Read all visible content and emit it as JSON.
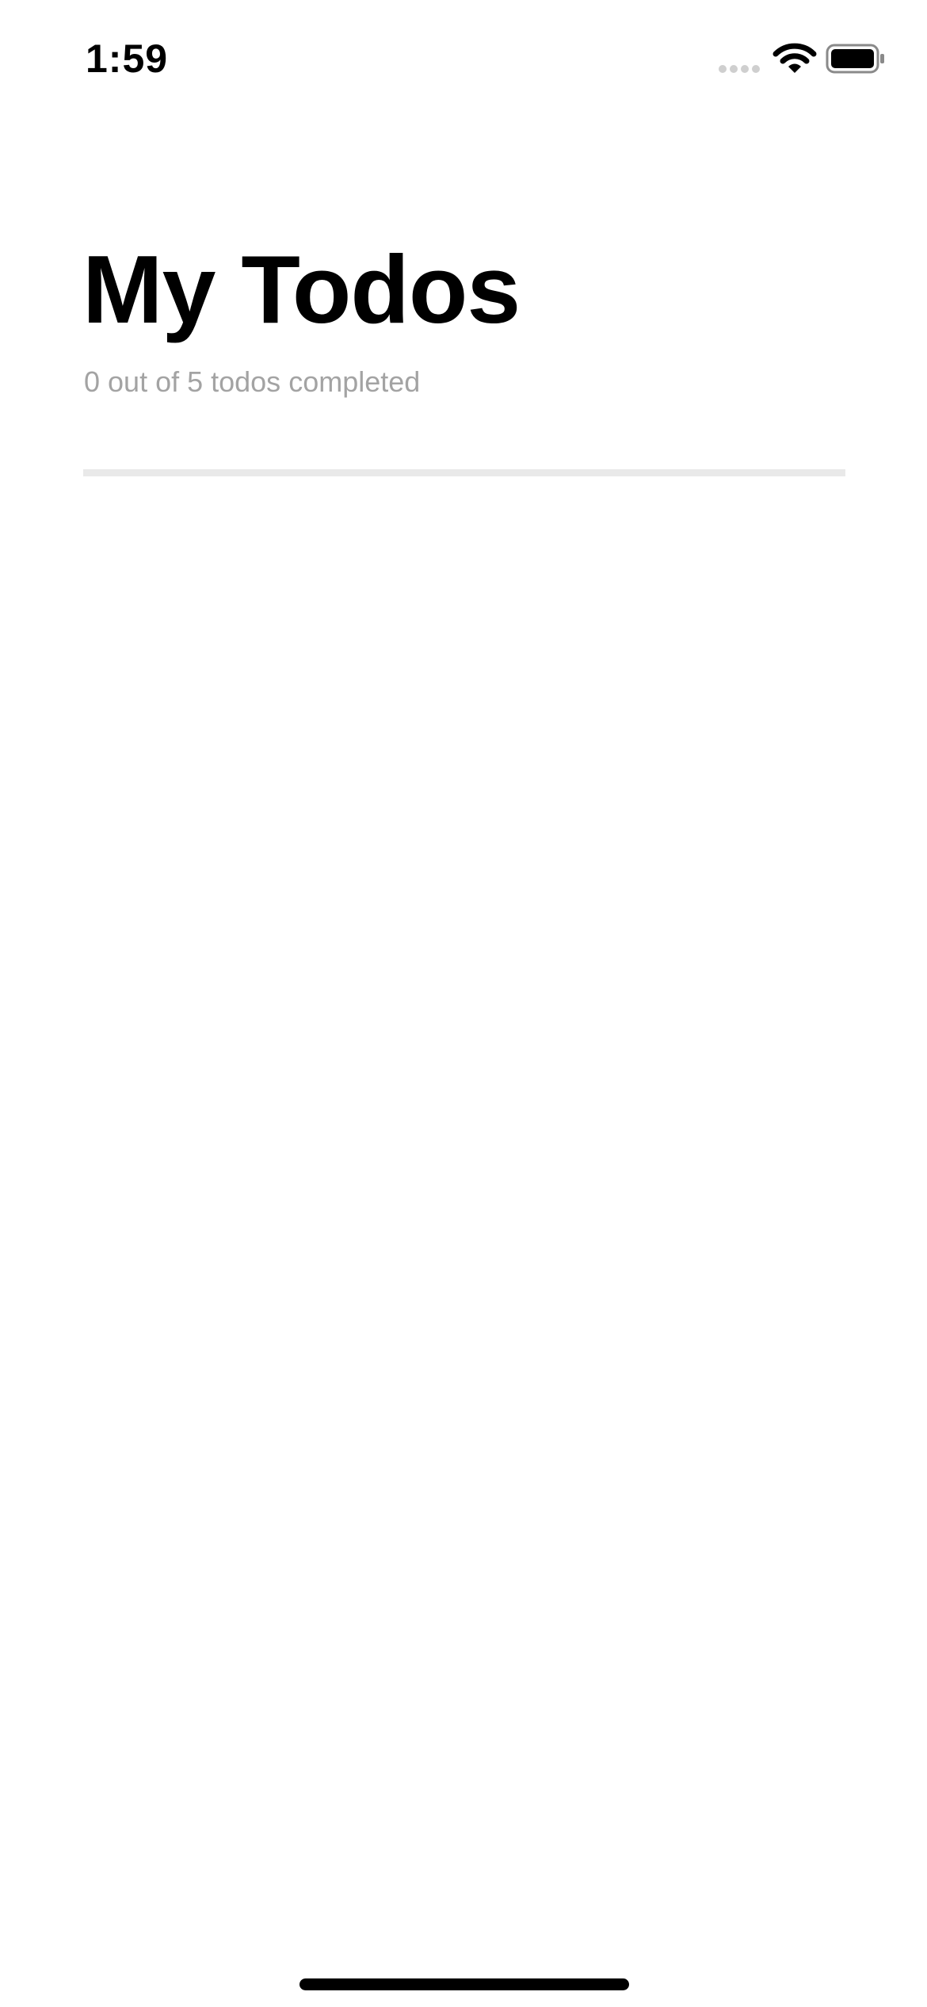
{
  "status_bar": {
    "time": "1:59",
    "icons": [
      "signal-icon",
      "wifi-icon",
      "battery-icon"
    ]
  },
  "header": {
    "title": "My Todos",
    "subtitle": "0 out of 5 todos completed"
  },
  "progress": {
    "completed": 0,
    "total": 5,
    "fraction": 0,
    "track_color": "#e9e9e9"
  },
  "todos": []
}
